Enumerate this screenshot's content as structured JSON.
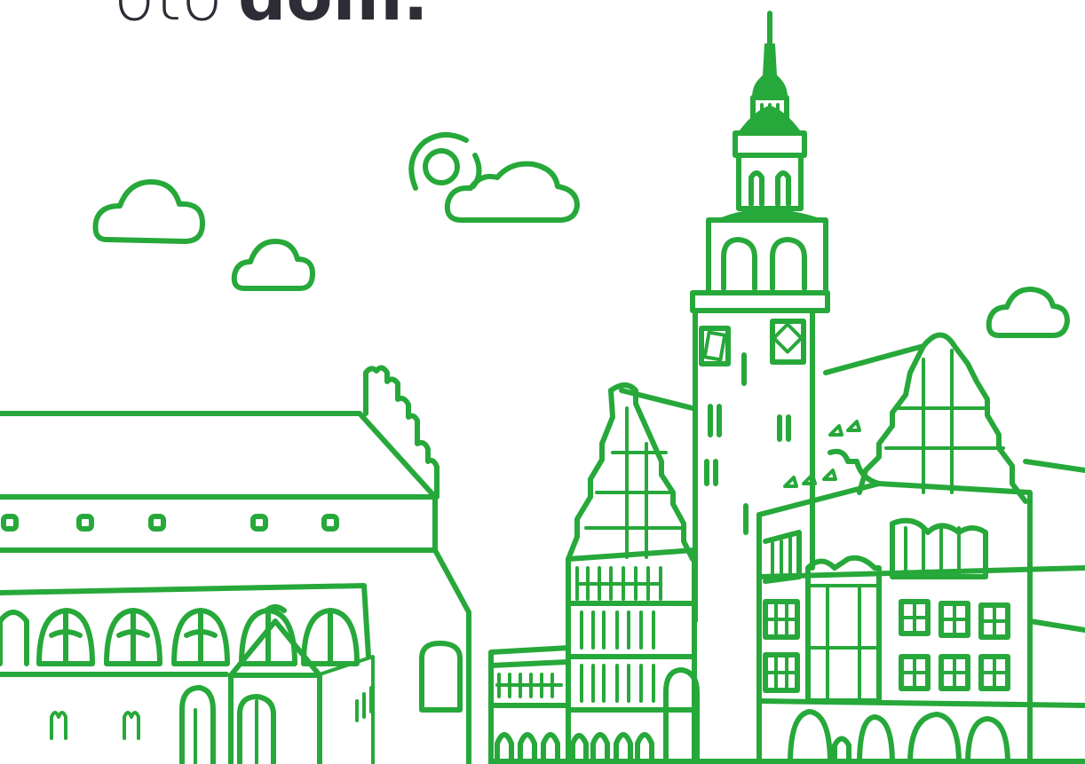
{
  "logo": {
    "text_light": "oto",
    "text_bold": "dom.",
    "dark_color": "#2d2d37"
  },
  "illustration": {
    "line_color": "#27a83a",
    "subject": "town-hall-and-church"
  }
}
